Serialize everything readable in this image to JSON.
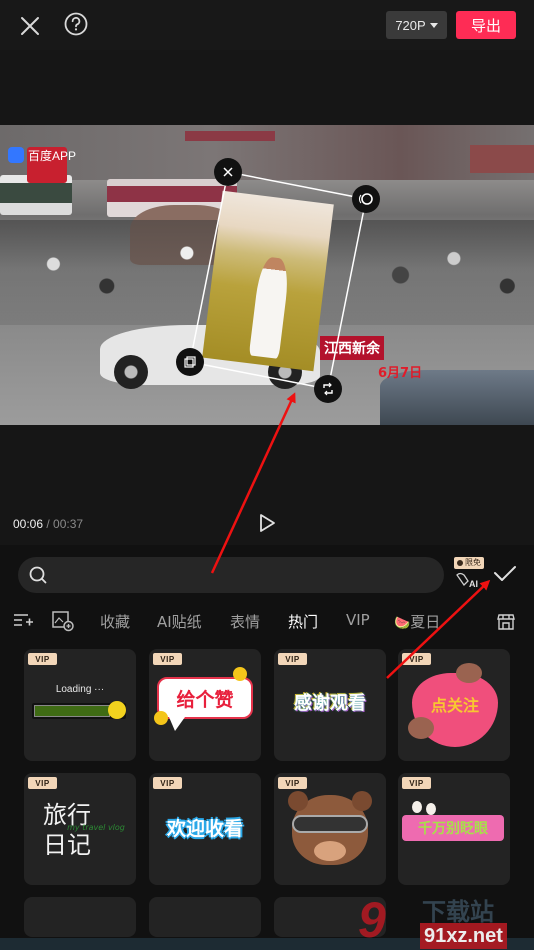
{
  "topbar": {
    "close_icon": "close-icon",
    "help_icon": "help-icon",
    "resolution": "720P",
    "export_label": "导出"
  },
  "preview": {
    "video_overlay": {
      "source_logo_text": "百度APP",
      "caption": "江西新余",
      "date": "6月7日"
    },
    "sticker_handles": [
      "delete-handle",
      "rotate-handle",
      "flip-handle",
      "scale-handle"
    ]
  },
  "playback": {
    "current_time": "00:06",
    "separator": " / ",
    "total_time": "00:37",
    "play_icon": "play-icon"
  },
  "panel": {
    "search": {
      "placeholder": "",
      "value": ""
    },
    "ai_badge": "限免",
    "ai_label": "AI",
    "tabs": [
      {
        "label": "收藏",
        "active": false
      },
      {
        "label": "AI贴纸",
        "active": false
      },
      {
        "label": "表情",
        "active": false
      },
      {
        "label": "热门",
        "active": true
      },
      {
        "label": "VIP",
        "active": false
      },
      {
        "label": "夏日",
        "active": false,
        "emoji": "🍉"
      }
    ],
    "stickers": [
      {
        "name": "loading",
        "badge": "VIP",
        "text": "Loading ···"
      },
      {
        "name": "give-like",
        "badge": "VIP",
        "text": "给个赞"
      },
      {
        "name": "thanks-for-watching",
        "badge": "VIP",
        "text": "感谢观看"
      },
      {
        "name": "follow-heart",
        "badge": "VIP",
        "text": "点关注"
      },
      {
        "name": "travel-diary",
        "badge": "VIP",
        "text": "旅行日记",
        "subtext": "my travel vlog"
      },
      {
        "name": "welcome-watch",
        "badge": "VIP",
        "text": "欢迎收看"
      },
      {
        "name": "cool-bear",
        "badge": "VIP",
        "text": ""
      },
      {
        "name": "dont-blink",
        "badge": "VIP",
        "text": "千万别眨眼"
      }
    ]
  },
  "watermark": {
    "logo": "9",
    "site_cn": "下载站",
    "site_url": "91xz.net"
  }
}
